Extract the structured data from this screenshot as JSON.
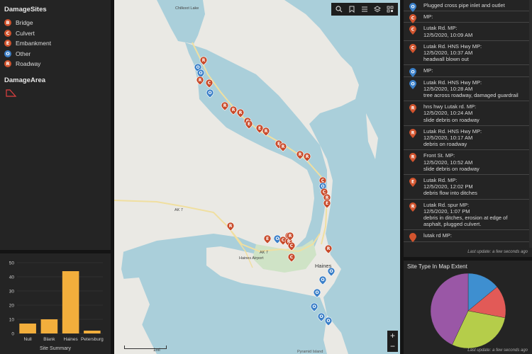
{
  "legend": {
    "sites_title": "DamageSites",
    "items": [
      {
        "letter": "B",
        "label": "Bridge",
        "color": "#d2542e"
      },
      {
        "letter": "C",
        "label": "Culvert",
        "color": "#d2542e"
      },
      {
        "letter": "E",
        "label": "Embankment",
        "color": "#d2542e"
      },
      {
        "letter": "O",
        "label": "Other",
        "color": "#3a7fc8"
      },
      {
        "letter": "R",
        "label": "Roadway",
        "color": "#d2542e"
      }
    ],
    "area_title": "DamageArea"
  },
  "chart_data": [
    {
      "type": "bar",
      "title": "Site Summary",
      "categories": [
        "Null",
        "Blank",
        "Haines",
        "Petersburg"
      ],
      "values": [
        7,
        10,
        44,
        2
      ],
      "ylim": [
        0,
        50
      ],
      "yticks": [
        0,
        10,
        20,
        30,
        40,
        50
      ],
      "color": "#f2ae3c",
      "grid": true
    },
    {
      "type": "pie",
      "title": "Site Type In Map Extent",
      "slices": [
        {
          "value": 14,
          "color": "#3e8fd0"
        },
        {
          "value": 14,
          "color": "#e25a57"
        },
        {
          "value": 29,
          "color": "#b5cd4a"
        },
        {
          "value": 43,
          "color": "#9a57a6"
        }
      ]
    }
  ],
  "map": {
    "toolbar": [
      "search-icon",
      "bookmark-icon",
      "list-icon",
      "layers-icon",
      "qr-icon"
    ],
    "zoom_in": "+",
    "zoom_out": "−",
    "scale_label": "1mi",
    "places": [
      "Chilkoot Lake",
      "AK 7",
      "AK 7",
      "Haines",
      "Haines Airport"
    ],
    "attribution": "Pyramid Island",
    "pin_color_red": "#c84a2a",
    "pin_color_blue": "#3a7fc8"
  },
  "list": {
    "items": [
      {
        "letter": "O",
        "color": "#3a7fc8",
        "lines": [
          "Plugged cross pipe inlet and outlet"
        ]
      },
      {
        "letter": "C",
        "color": "#d2542e",
        "lines": [
          "MP:"
        ]
      },
      {
        "letter": "C",
        "color": "#d2542e",
        "lines": [
          "Lutak Rd. MP:",
          "12/5/2020, 10:09 AM"
        ]
      },
      {
        "letter": "C",
        "color": "#d2542e",
        "lines": [
          "Lutak Rd. HNS Hwy MP:",
          "12/5/2020, 10:37 AM",
          "headwall blown out"
        ]
      },
      {
        "letter": "O",
        "color": "#3a7fc8",
        "lines": [
          "MP:"
        ]
      },
      {
        "letter": "O",
        "color": "#3a7fc8",
        "lines": [
          "Lutak Rd. HNS Hwy MP:",
          "12/5/2020, 10:28 AM",
          "tree across roadway, damaged guardrail"
        ]
      },
      {
        "letter": "R",
        "color": "#d2542e",
        "lines": [
          "hns hwy Lutak rd. MP:",
          "12/5/2020, 10:24 AM",
          "slide debris on roadway"
        ]
      },
      {
        "letter": "R",
        "color": "#d2542e",
        "lines": [
          "Lutak Rd. HNS Hwy MP:",
          "12/5/2020, 10:17 AM",
          "debris on roadway"
        ]
      },
      {
        "letter": "R",
        "color": "#d2542e",
        "lines": [
          "Front St. MP:",
          "12/5/2020, 10:52 AM",
          "slide debris on roadway"
        ]
      },
      {
        "letter": "E",
        "color": "#d2542e",
        "lines": [
          "Lutak Rd. MP:",
          "12/5/2020, 12:02 PM",
          "debris flow into ditches"
        ]
      },
      {
        "letter": "R",
        "color": "#d2542e",
        "lines": [
          "Lutak Rd. spur MP:",
          "12/5/2020, 1:07 PM",
          "debris in ditches, erosion at edge of",
          "asphalt, plugged culvert."
        ]
      },
      {
        "letter": "",
        "color": "#d2542e",
        "lines": [
          "lutak rd MP:"
        ]
      }
    ],
    "footer": "Last update: a few seconds ago"
  },
  "pie_footer": "Last update: a few seconds ago"
}
